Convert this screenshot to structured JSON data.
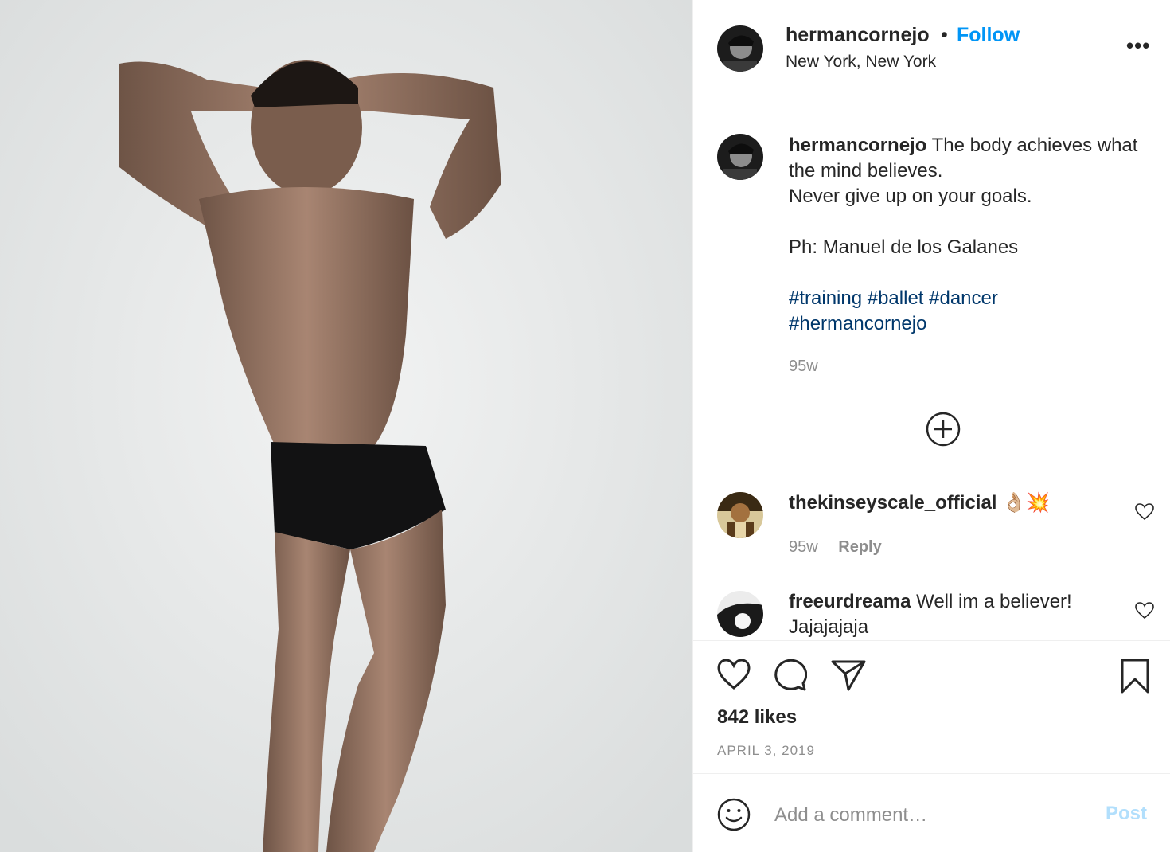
{
  "post": {
    "image_alt": "Shirtless dancer posing with arms folded over his head"
  },
  "header": {
    "username": "hermancornejo",
    "separator": "•",
    "follow_label": "Follow",
    "location": "New York, New York",
    "more_label": "•••"
  },
  "caption": {
    "username": "hermancornejo",
    "line1": "The body achieves what the mind believes.",
    "line2": "Never give up on your goals.",
    "line3": "Ph: Manuel de los Galanes",
    "hashtags": "#training #ballet #dancer #hermancornejo",
    "time": "95w"
  },
  "comments": [
    {
      "username": "thekinseyscale_official",
      "text": "👌🏼💥",
      "time": "95w",
      "reply_label": "Reply"
    },
    {
      "username": "freeurdreama",
      "text": "Well im a believer! Jajajajaja"
    }
  ],
  "footer": {
    "likes": "842 likes",
    "date": "APRIL 3, 2019",
    "comment_placeholder": "Add a comment…",
    "post_label": "Post"
  },
  "colors": {
    "link_blue": "#0095f6",
    "hashtag": "#00376b",
    "muted": "#8e8e8e",
    "post_disabled": "#b2dffc"
  }
}
